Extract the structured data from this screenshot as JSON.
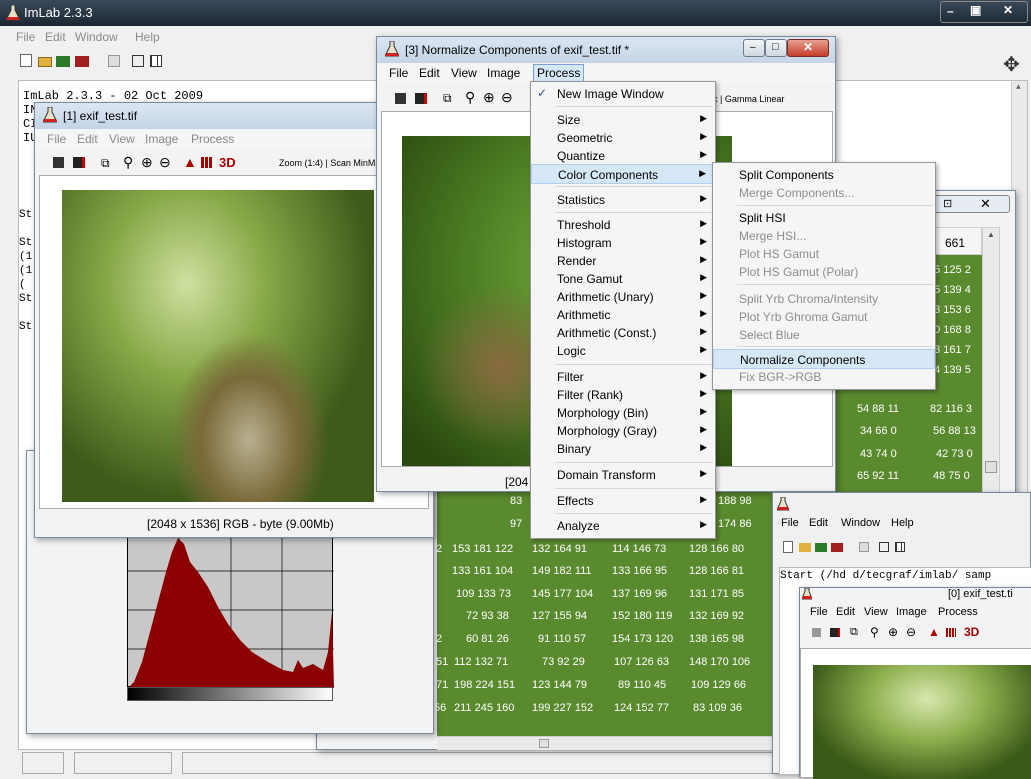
{
  "app": {
    "title": "ImLab 2.3.3",
    "menu": [
      "File",
      "Edit",
      "Window",
      "Help"
    ],
    "version_line": "ImLab 2.3.3 - 02 Oct 2009",
    "console_lines": [
      "IN",
      "CI",
      "IU",
      "St",
      "St",
      "(1",
      "(1",
      "(",
      "St",
      "St"
    ]
  },
  "win1": {
    "title": "[1] exif_test.tif",
    "menu": [
      "File",
      "Edit",
      "View",
      "Image",
      "Process"
    ],
    "zoom": "Zoom (1:4) | Scan MinMa",
    "status": "[2048 x 1536] RGB - byte (9.00Mb)",
    "tb_3d": "3D"
  },
  "win3": {
    "title": "[3] Normalize Components of exif_test.tif *",
    "menu": [
      "File",
      "Edit",
      "View",
      "Image",
      "Process"
    ],
    "zoom": "x | Gamma Linear",
    "status": "[204"
  },
  "process_menu": {
    "items": [
      {
        "label": "New Image Window",
        "checked": true,
        "sub": false
      },
      {
        "label": "Size",
        "sub": true
      },
      {
        "label": "Geometric",
        "sub": true
      },
      {
        "label": "Quantize",
        "sub": true
      },
      {
        "label": "Color Components",
        "sub": true,
        "active": true
      },
      {
        "label": "Statistics",
        "sub": true
      },
      {
        "label": "Threshold",
        "sub": true
      },
      {
        "label": "Histogram",
        "sub": true
      },
      {
        "label": "Render",
        "sub": true
      },
      {
        "label": "Tone Gamut",
        "sub": true
      },
      {
        "label": "Arithmetic (Unary)",
        "sub": true
      },
      {
        "label": "Arithmetic",
        "sub": true
      },
      {
        "label": "Arithmetic (Const.)",
        "sub": true
      },
      {
        "label": "Logic",
        "sub": true
      },
      {
        "label": "Filter",
        "sub": true
      },
      {
        "label": "Filter (Rank)",
        "sub": true
      },
      {
        "label": "Morphology (Bin)",
        "sub": true
      },
      {
        "label": "Morphology (Gray)",
        "sub": true
      },
      {
        "label": "Binary",
        "sub": true
      },
      {
        "label": "Domain Transform",
        "sub": true
      },
      {
        "label": "Effects",
        "sub": true
      },
      {
        "label": "Analyze",
        "sub": true
      }
    ]
  },
  "color_submenu": {
    "items": [
      {
        "label": "Split Components",
        "enabled": true
      },
      {
        "label": "Merge Components...",
        "enabled": false
      },
      {
        "label": "Split HSI",
        "enabled": true
      },
      {
        "label": "Merge HSI...",
        "enabled": false
      },
      {
        "label": "Plot HS Gamut",
        "enabled": false
      },
      {
        "label": "Plot HS Gamut (Polar)",
        "enabled": false
      },
      {
        "label": "Split Yrb Chroma/Intensity",
        "enabled": false
      },
      {
        "label": "Plot Yrb Ghroma Gamut",
        "enabled": false
      },
      {
        "label": "Select Blue",
        "enabled": false
      },
      {
        "label": "Normalize Components",
        "enabled": true,
        "active": true
      },
      {
        "label": "Fix BGR->RGB",
        "enabled": false
      }
    ]
  },
  "table": {
    "header": "661",
    "right_col": [
      "35 125 2",
      "95 139 4",
      "13 153 6",
      "30 168 8",
      "23 161 7",
      "04 139 5"
    ],
    "mid_rows": [
      [
        "54 88 11",
        "82 116 3"
      ],
      [
        "34 66 0",
        "56 88 13"
      ],
      [
        "43 74 0",
        "42 73 0"
      ],
      [
        "65 92 11",
        "48 75 0"
      ]
    ],
    "left_frag": [
      "83",
      "97",
      "2",
      "",
      "",
      "2",
      "51",
      "71",
      "56"
    ],
    "rows": [
      [
        "",
        "188 98"
      ],
      [
        "",
        "174 86"
      ],
      [
        "153 181 122",
        "132 164 91",
        "114 146 73",
        "128 166 80"
      ],
      [
        "133 161 104",
        "149 182 111",
        "133 166 95",
        "128 166 81"
      ],
      [
        "109 133 73",
        "145 177 104",
        "137 169 96",
        "131 171 85"
      ],
      [
        "72 93 38",
        "127 155 94",
        "152 180 119",
        "132 169 92"
      ],
      [
        "60 81 26",
        "91 110 57",
        "154 173 120",
        "138 165 98"
      ],
      [
        "112 132 71",
        "73 92 29",
        "107 126 63",
        "148 170 106"
      ],
      [
        "198 224 151",
        "123 144 79",
        "89 110 45",
        "109 129 66"
      ],
      [
        "211 245 160",
        "199 227 152",
        "124 152 77",
        "83 109 36"
      ]
    ]
  },
  "win0": {
    "title": "[0] exif_test.ti",
    "menu": [
      "File",
      "Edit",
      "Window",
      "Help"
    ],
    "inner_menu": [
      "File",
      "Edit",
      "View",
      "Image",
      "Process"
    ],
    "console": "Start (/hd d/tecgraf/imlab/ samp",
    "tb_3d": "3D"
  }
}
